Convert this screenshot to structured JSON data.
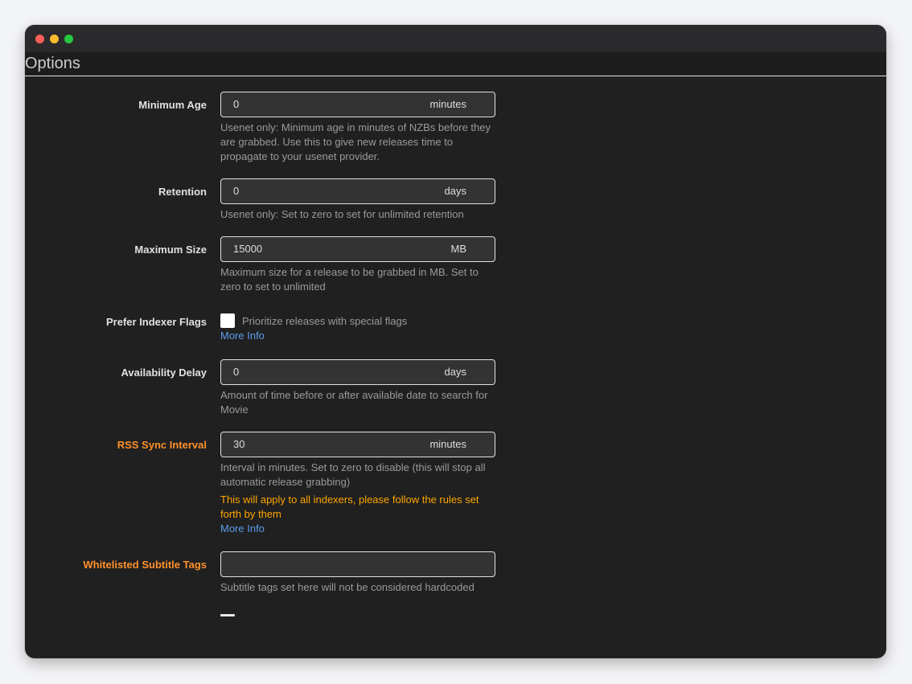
{
  "section": {
    "title": "Options"
  },
  "fields": {
    "minimum_age": {
      "label": "Minimum Age",
      "value": "0",
      "unit": "minutes",
      "help": "Usenet only: Minimum age in minutes of NZBs before they are grabbed. Use this to give new releases time to propagate to your usenet provider."
    },
    "retention": {
      "label": "Retention",
      "value": "0",
      "unit": "days",
      "help": "Usenet only: Set to zero to set for unlimited retention"
    },
    "maximum_size": {
      "label": "Maximum Size",
      "value": "15000",
      "unit": "MB",
      "help": "Maximum size for a release to be grabbed in MB. Set to zero to set to unlimited"
    },
    "prefer_indexer_flags": {
      "label": "Prefer Indexer Flags",
      "checkbox_label": "Prioritize releases with special flags",
      "more_info": "More Info"
    },
    "availability_delay": {
      "label": "Availability Delay",
      "value": "0",
      "unit": "days",
      "help": "Amount of time before or after available date to search for Movie"
    },
    "rss_sync_interval": {
      "label": "RSS Sync Interval",
      "value": "30",
      "unit": "minutes",
      "help": "Interval in minutes. Set to zero to disable (this will stop all automatic release grabbing)",
      "warning": "This will apply to all indexers, please follow the rules set forth by them",
      "more_info": "More Info"
    },
    "whitelisted_subtitle_tags": {
      "label": "Whitelisted Subtitle Tags",
      "value": "",
      "help": "Subtitle tags set here will not be considered hardcoded"
    }
  },
  "colors": {
    "advanced_label": "#ff902b",
    "warning_text": "#ffa500",
    "link": "#5d9cec"
  }
}
